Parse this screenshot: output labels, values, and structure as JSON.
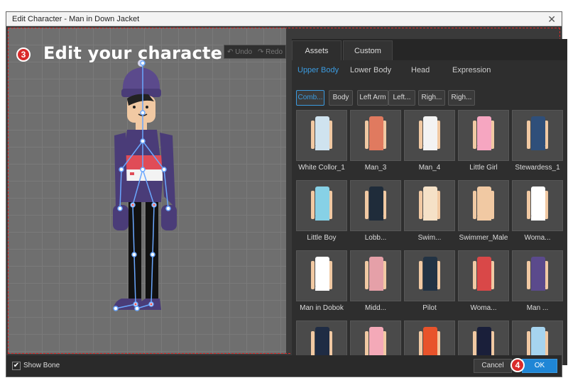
{
  "window": {
    "title": "Edit Character - Man in Down Jacket"
  },
  "canvas": {
    "step_number": "3",
    "step_text": "Edit your character",
    "undo_label": "Undo",
    "redo_label": "Redo"
  },
  "tabs": [
    {
      "label": "Assets",
      "active": true
    },
    {
      "label": "Custom",
      "active": false
    }
  ],
  "subtabs": [
    {
      "label": "Upper Body",
      "active": true
    },
    {
      "label": "Lower Body",
      "active": false
    },
    {
      "label": "Head",
      "active": false
    },
    {
      "label": "Expression",
      "active": false
    }
  ],
  "filters": [
    {
      "label": "Comb...",
      "active": true
    },
    {
      "label": "Body",
      "active": false
    },
    {
      "label": "Left Arm",
      "active": false
    },
    {
      "label": "Left...",
      "active": false
    },
    {
      "label": "Righ...",
      "active": false
    },
    {
      "label": "Righ...",
      "active": false
    }
  ],
  "assets": [
    {
      "label": "White Collor_1",
      "color": "#cfe3ef"
    },
    {
      "label": "Man_3",
      "color": "#e07a5f"
    },
    {
      "label": "Man_4",
      "color": "#f3f3f3"
    },
    {
      "label": "Little Girl",
      "color": "#f6a6c1"
    },
    {
      "label": "Stewardess_1",
      "color": "#2f4f7a"
    },
    {
      "label": "Little Boy",
      "color": "#87d1e6"
    },
    {
      "label": "Lobb...",
      "color": "#1f2c3a"
    },
    {
      "label": "Swim...",
      "color": "#f5e1c7"
    },
    {
      "label": "Swimmer_Male",
      "color": "#f1c9a3"
    },
    {
      "label": "Woma...",
      "color": "#ffffff"
    },
    {
      "label": "Man in Dobok",
      "color": "#ffffff"
    },
    {
      "label": "Midd...",
      "color": "#e5a0a8"
    },
    {
      "label": "Pilot",
      "color": "#223344"
    },
    {
      "label": "Woma...",
      "color": "#d94848"
    },
    {
      "label": "Man ...",
      "color": "#5b4a8c"
    },
    {
      "label": "",
      "color": "#1f2c44"
    },
    {
      "label": "",
      "color": "#f4a9b8"
    },
    {
      "label": "",
      "color": "#e8532b"
    },
    {
      "label": "",
      "color": "#1a1f3a"
    },
    {
      "label": "",
      "color": "#a6d4ef"
    }
  ],
  "footer": {
    "show_bone_label": "Show Bone",
    "show_bone_checked": true,
    "cancel_label": "Cancel",
    "ok_label": "OK",
    "step_number": "4"
  }
}
